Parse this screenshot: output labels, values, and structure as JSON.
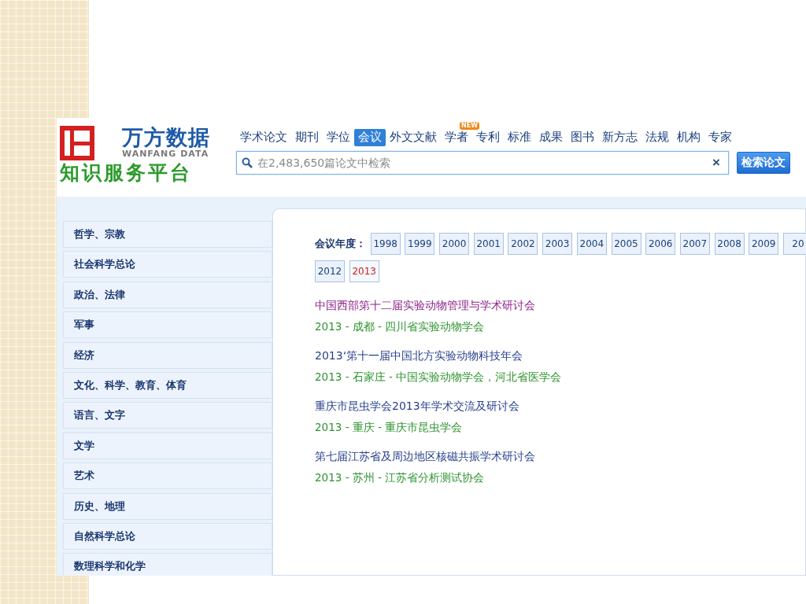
{
  "logo": {
    "name": "万方数据",
    "subtitle": "WANFANG DATA",
    "tagline": "知识服务平台"
  },
  "nav": [
    {
      "label": "学术论文",
      "selected": false
    },
    {
      "label": "期刊",
      "selected": false
    },
    {
      "label": "学位",
      "selected": false
    },
    {
      "label": "会议",
      "selected": true
    },
    {
      "label": "外文文献",
      "selected": false
    },
    {
      "label": "学者",
      "selected": false,
      "badge": "NEW"
    },
    {
      "label": "专利",
      "selected": false
    },
    {
      "label": "标准",
      "selected": false
    },
    {
      "label": "成果",
      "selected": false
    },
    {
      "label": "图书",
      "selected": false
    },
    {
      "label": "新方志",
      "selected": false
    },
    {
      "label": "法规",
      "selected": false
    },
    {
      "label": "机构",
      "selected": false
    },
    {
      "label": "专家",
      "selected": false
    }
  ],
  "search": {
    "placeholder": "在2,483,650篇论文中检索",
    "clear": "×",
    "buttons": [
      "检索论文"
    ]
  },
  "sidebar": {
    "items": [
      "哲学、宗教",
      "社会科学总论",
      "政治、法律",
      "军事",
      "经济",
      "文化、科学、教育、体育",
      "语言、文字",
      "文学",
      "艺术",
      "历史、地理",
      "自然科学总论",
      "数理科学和化学"
    ]
  },
  "years": {
    "label": "会议年度：",
    "rows": [
      [
        {
          "label": "1998",
          "selected": false
        },
        {
          "label": "1999",
          "selected": false
        },
        {
          "label": "2000",
          "selected": false
        },
        {
          "label": "2001",
          "selected": false
        },
        {
          "label": "2002",
          "selected": false
        },
        {
          "label": "2003",
          "selected": false
        },
        {
          "label": "2004",
          "selected": false
        },
        {
          "label": "2005",
          "selected": false
        },
        {
          "label": "2006",
          "selected": false
        },
        {
          "label": "2007",
          "selected": false
        },
        {
          "label": "2008",
          "selected": false
        },
        {
          "label": "2009",
          "selected": false
        },
        {
          "label": "20",
          "selected": false
        }
      ],
      [
        {
          "label": "2012",
          "selected": false
        },
        {
          "label": "2013",
          "selected": true
        }
      ]
    ]
  },
  "conferences": [
    {
      "title": "中国西部第十二届实验动物管理与学术研讨会",
      "visited": true,
      "info": "2013 - 成都 - 四川省实验动物学会"
    },
    {
      "title": "2013‘第十一届中国北方实验动物科技年会",
      "visited": false,
      "info": "2013 - 石家庄 - 中国实验动物学会，河北省医学会"
    },
    {
      "title": "重庆市昆虫学会2013年学术交流及研讨会",
      "visited": false,
      "info": "2013 - 重庆 - 重庆市昆虫学会"
    },
    {
      "title": "第七届江苏省及周边地区核磁共振学术研讨会",
      "visited": false,
      "info": "2013 - 苏州 - 江苏省分析测试协会"
    }
  ]
}
